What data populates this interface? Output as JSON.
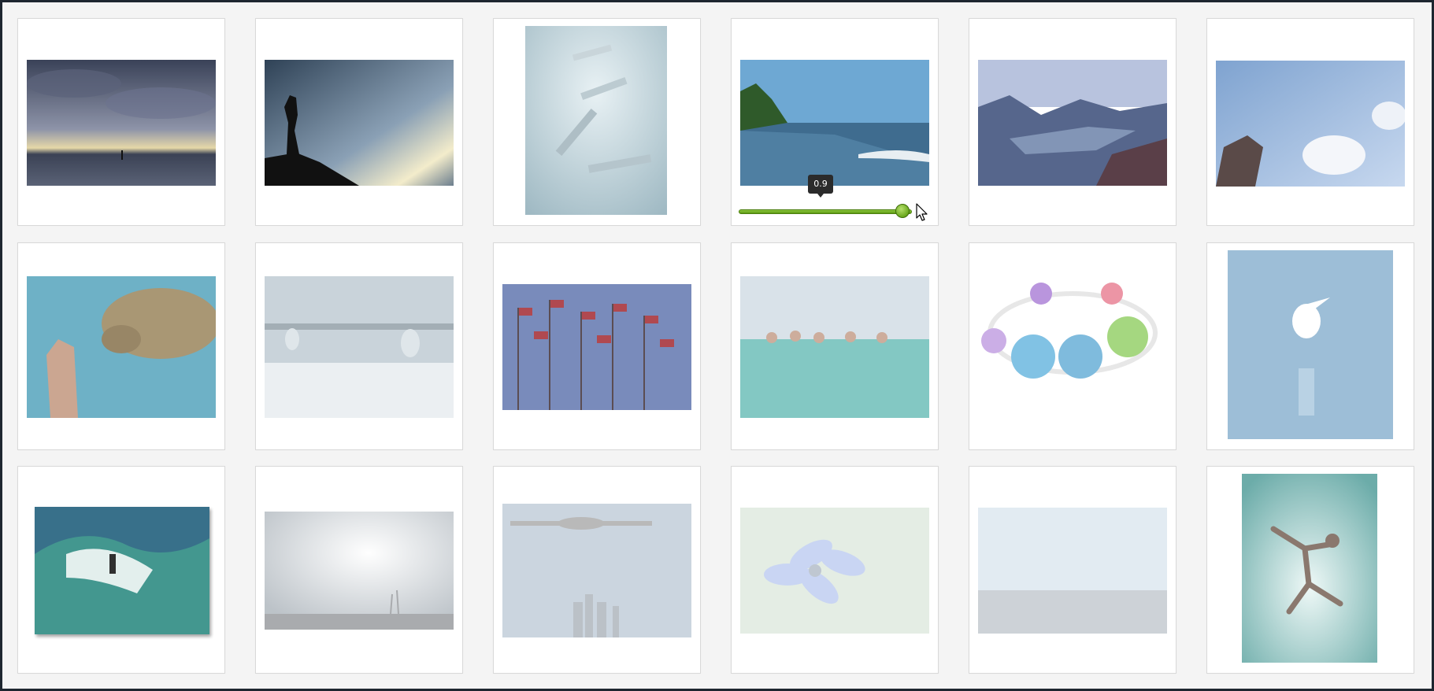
{
  "gallery": {
    "items": [
      {
        "name": "stormy-beach",
        "opacity": 1.0
      },
      {
        "name": "silhouette-cliff",
        "opacity": 1.0
      },
      {
        "name": "clothespins-sculpture",
        "opacity": 1.0
      },
      {
        "name": "tropical-beach",
        "opacity": 1.0
      },
      {
        "name": "mountain-lake",
        "opacity": 1.0
      },
      {
        "name": "kite-sky",
        "opacity": 1.0
      },
      {
        "name": "turtle-diver",
        "opacity": 0.9
      },
      {
        "name": "water-droplets",
        "opacity": 0.8
      },
      {
        "name": "red-flags",
        "opacity": 0.9
      },
      {
        "name": "swimmers",
        "opacity": 0.7
      },
      {
        "name": "fabric-bracelet",
        "opacity": 0.6
      },
      {
        "name": "egret-water",
        "opacity": 0.5
      },
      {
        "name": "surfer",
        "opacity": 0.9
      },
      {
        "name": "cloudy-palms",
        "opacity": 0.4
      },
      {
        "name": "bomber-plane",
        "opacity": 0.35
      },
      {
        "name": "blue-flower",
        "opacity": 0.3
      },
      {
        "name": "misty-field",
        "opacity": 0.25
      },
      {
        "name": "jumping-man",
        "opacity": 0.7
      }
    ]
  },
  "slider": {
    "value": 0.9,
    "min": 0,
    "max": 1,
    "value_label": "0.9"
  },
  "colors": {
    "accent": "#6aa81d",
    "tooltip_bg": "#2b2b2b"
  }
}
